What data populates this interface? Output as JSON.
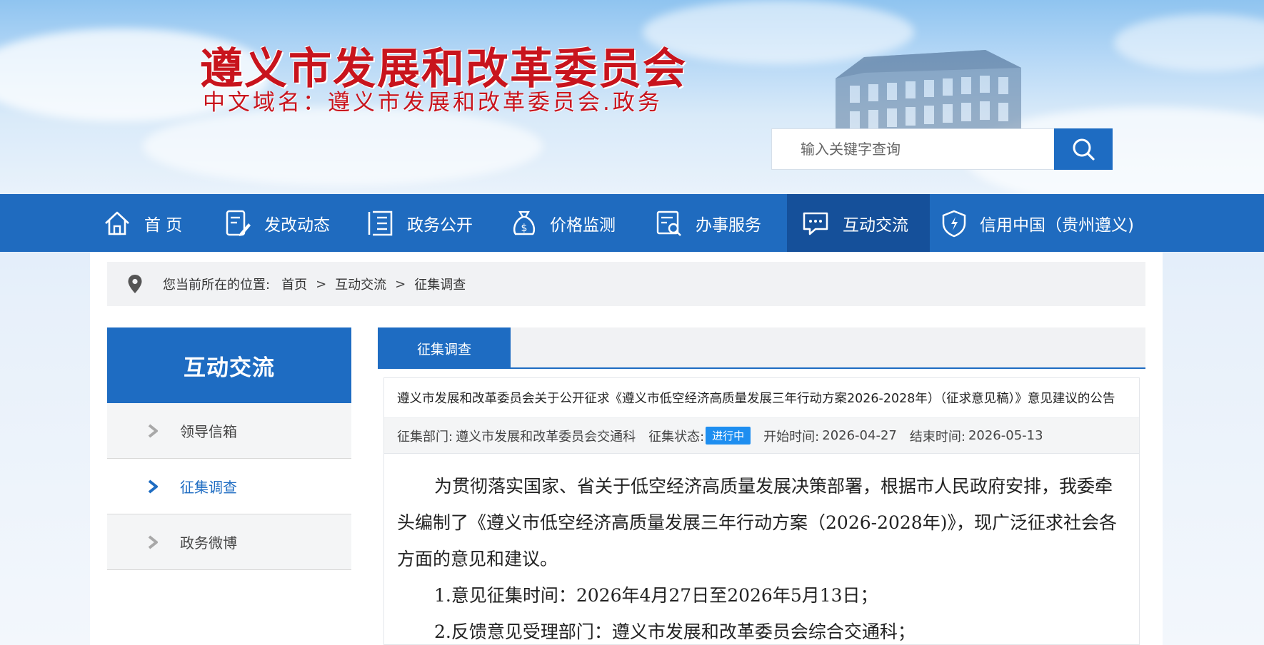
{
  "header": {
    "site_title": "遵义市发展和改革委员会",
    "site_domain": "中文域名：遵义市发展和改革委员会.政务",
    "search_placeholder": "输入关键字查询",
    "search_icon": "search-icon"
  },
  "nav": {
    "items": [
      {
        "label": "首 页",
        "icon": "home-icon"
      },
      {
        "label": "发改动态",
        "icon": "document-edit-icon"
      },
      {
        "label": "政务公开",
        "icon": "list-icon"
      },
      {
        "label": "价格监测",
        "icon": "money-bag-icon"
      },
      {
        "label": "办事服务",
        "icon": "service-search-icon"
      },
      {
        "label": "互动交流",
        "icon": "chat-icon"
      },
      {
        "label": "信用中国（贵州遵义)",
        "icon": "shield-icon"
      }
    ],
    "active_index": 5
  },
  "breadcrumb": {
    "prefix": "您当前所在的位置:",
    "items": [
      "首页",
      "互动交流",
      "征集调查"
    ],
    "separator": ">"
  },
  "sidebar": {
    "title": "互动交流",
    "items": [
      {
        "label": "领导信箱"
      },
      {
        "label": "征集调查"
      },
      {
        "label": "政务微博"
      }
    ],
    "active_index": 1
  },
  "main": {
    "tab_label": "征集调查",
    "article": {
      "title": "遵义市发展和改革委员会关于公开征求《遵义市低空经济高质量发展三年行动方案2026-2028年）（征求意见稿）》意见建议的公告",
      "meta": {
        "dept_label": "征集部门:",
        "dept_value": "遵义市发展和改革委员会交通科",
        "status_label": "征集状态:",
        "status_value": "进行中",
        "start_label": "开始时间:",
        "start_value": "2026-04-27",
        "end_label": "结束时间:",
        "end_value": "2026-05-13"
      },
      "paragraphs": [
        "为贯彻落实国家、省关于低空经济高质量发展决策部署，根据市人民政府安排，我委牵头编制了《遵义市低空经济高质量发展三年行动方案（2026-2028年)》，现广泛征求社会各方面的意见和建议。"
      ],
      "items": [
        "1.意见征集时间：2026年4月27日至2026年5月13日；",
        "2.反馈意见受理部门：遵义市发展和改革委员会综合交通科；"
      ]
    }
  },
  "colors": {
    "brand_blue": "#1e6cc2",
    "nav_active": "#15509a",
    "title_red": "#c8141d",
    "badge_blue": "#1e8ef0"
  }
}
